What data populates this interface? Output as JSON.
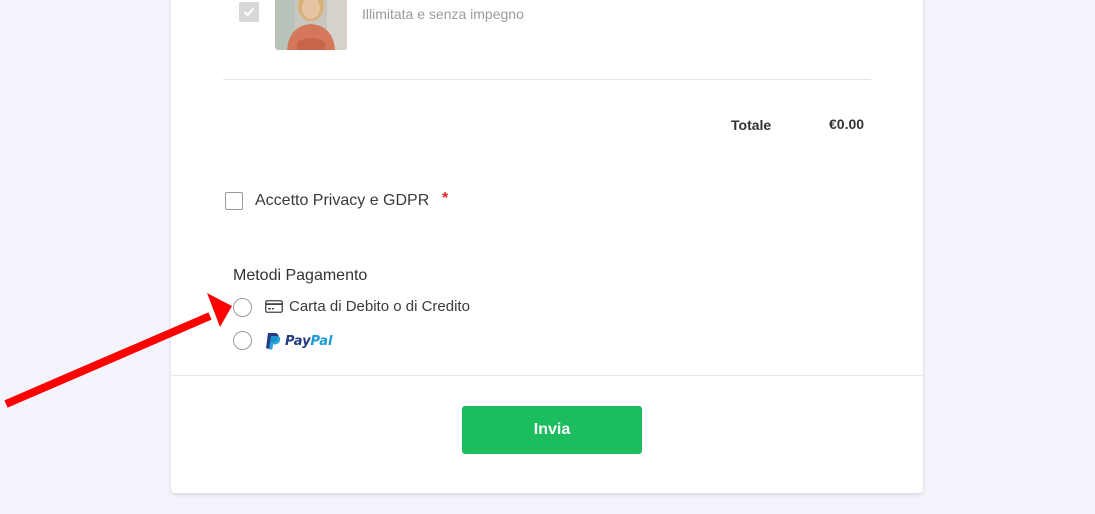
{
  "product": {
    "description": "Illimitata e senza impegno",
    "checked": true
  },
  "summary": {
    "total_label": "Totale",
    "total_value": "€0.00"
  },
  "privacy": {
    "label": "Accetto Privacy e GDPR",
    "required_mark": "*"
  },
  "payment": {
    "title": "Metodi Pagamento",
    "options": [
      {
        "label": "Carta di Debito o di Credito",
        "icon": "credit-card-icon"
      },
      {
        "label_part1": "Pay",
        "label_part2": "Pal",
        "icon": "paypal-logo"
      }
    ]
  },
  "submit": {
    "label": "Invia"
  },
  "colors": {
    "submit_bg": "#1bbd5e",
    "annotation_arrow": "#ff0000",
    "paypal_dark": "#253b80",
    "paypal_light": "#179bd7"
  }
}
